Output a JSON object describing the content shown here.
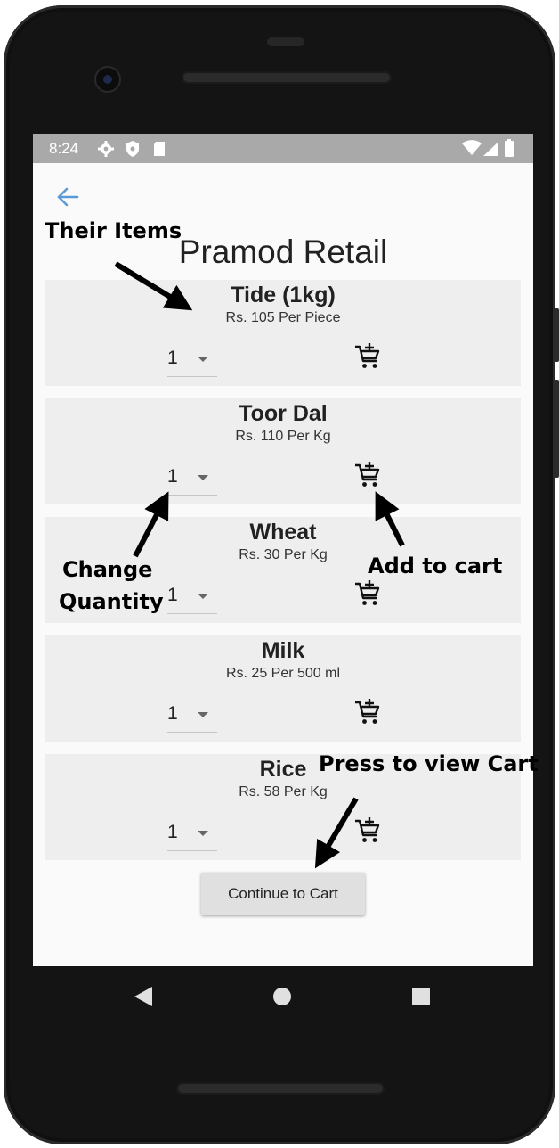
{
  "status_bar": {
    "time": "8:24"
  },
  "app": {
    "store_title": "Pramod Retail"
  },
  "items": [
    {
      "name": "Tide (1kg)",
      "price": "Rs. 105 Per Piece",
      "quantity": "1"
    },
    {
      "name": "Toor Dal",
      "price": "Rs. 110 Per Kg",
      "quantity": "1"
    },
    {
      "name": "Wheat",
      "price": "Rs. 30 Per Kg",
      "quantity": "1"
    },
    {
      "name": "Milk",
      "price": "Rs. 25 Per 500 ml",
      "quantity": "1"
    },
    {
      "name": "Rice",
      "price": "Rs. 58 Per Kg",
      "quantity": "1"
    }
  ],
  "continue_button": {
    "label": "Continue to Cart"
  },
  "annotations": {
    "their_items": "Their Items",
    "change_quantity_line1": "Change",
    "change_quantity_line2": "Quantity",
    "add_to_cart": "Add to cart",
    "press_to_view_cart": "Press to view Cart"
  },
  "icons": {
    "back": "arrow-left-icon",
    "add_to_cart": "cart-plus-icon",
    "dropdown": "caret-down-icon",
    "nav_back": "triangle-back-icon",
    "nav_home": "circle-home-icon",
    "nav_recents": "square-recents-icon"
  },
  "colors": {
    "back_arrow": "#5b9bd5",
    "status_bar": "#a9a9a9",
    "card_background": "#eeeeee",
    "button_background": "#e0e0e0"
  }
}
